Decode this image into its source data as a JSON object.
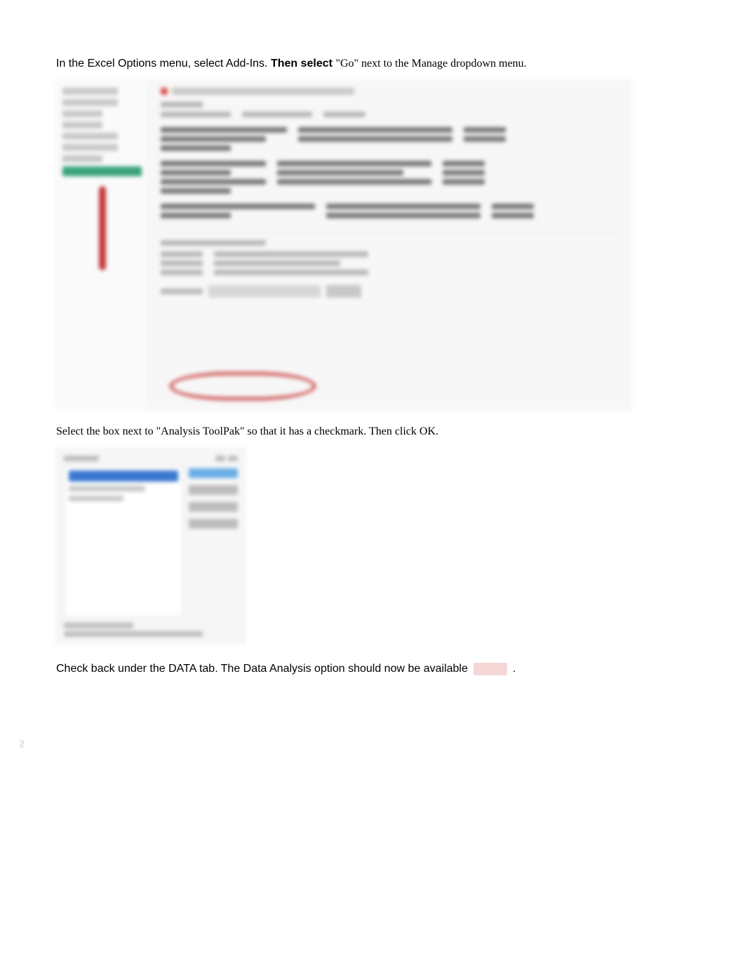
{
  "instruction1": {
    "part_a": "In the Excel Options menu, select Add-Ins.",
    "part_b_bold": "Then select",
    "part_c_serif": " \"Go\" next to the Manage dropdown menu."
  },
  "instruction2": "Select the box next to \"Analysis ToolPak\" so that it has a checkmark.  Then click OK.",
  "instruction3": {
    "part_a": "Check back under the DATA tab.",
    "part_b": "The Data Analysis option should now be available",
    "period": "."
  },
  "page_number": "2"
}
